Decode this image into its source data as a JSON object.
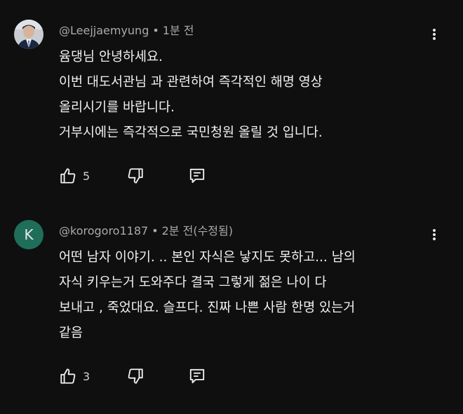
{
  "colors": {
    "background": "#0f0f0f",
    "text": "#f1f1f1",
    "meta": "#aaaaaa",
    "avatar_k": "#1f6e5a"
  },
  "comments": [
    {
      "author": "@Leejjaemyung",
      "separator": "•",
      "time": "1분 전",
      "avatar": "photo",
      "lines": [
        "윰댕님 안녕하세요.",
        "이번 대도서관님 과 관련하여 즉각적인 해명 영상",
        "올리시기를 바랍니다.",
        "거부시에는 즉각적으로 국민청원 올릴 것 입니다."
      ],
      "likes": "5",
      "icons": {
        "like": "thumbs-up-icon",
        "dislike": "thumbs-down-icon",
        "reply": "reply-icon",
        "more": "more-vert-icon"
      }
    },
    {
      "author": "@korogoro1187",
      "separator": "•",
      "time": "2분 전(수정됨)",
      "avatar": "K",
      "lines": [
        "어떤 남자 이야기. .. 본인 자식은 낳지도 못하고... 남의",
        "자식 키우는거 도와주다 결국 그렇게 젊은 나이 다",
        "보내고 , 죽었대요. 슬프다. 진짜 나쁜 사람 한명 있는거",
        "같음"
      ],
      "likes": "3",
      "icons": {
        "like": "thumbs-up-icon",
        "dislike": "thumbs-down-icon",
        "reply": "reply-icon",
        "more": "more-vert-icon"
      }
    }
  ]
}
